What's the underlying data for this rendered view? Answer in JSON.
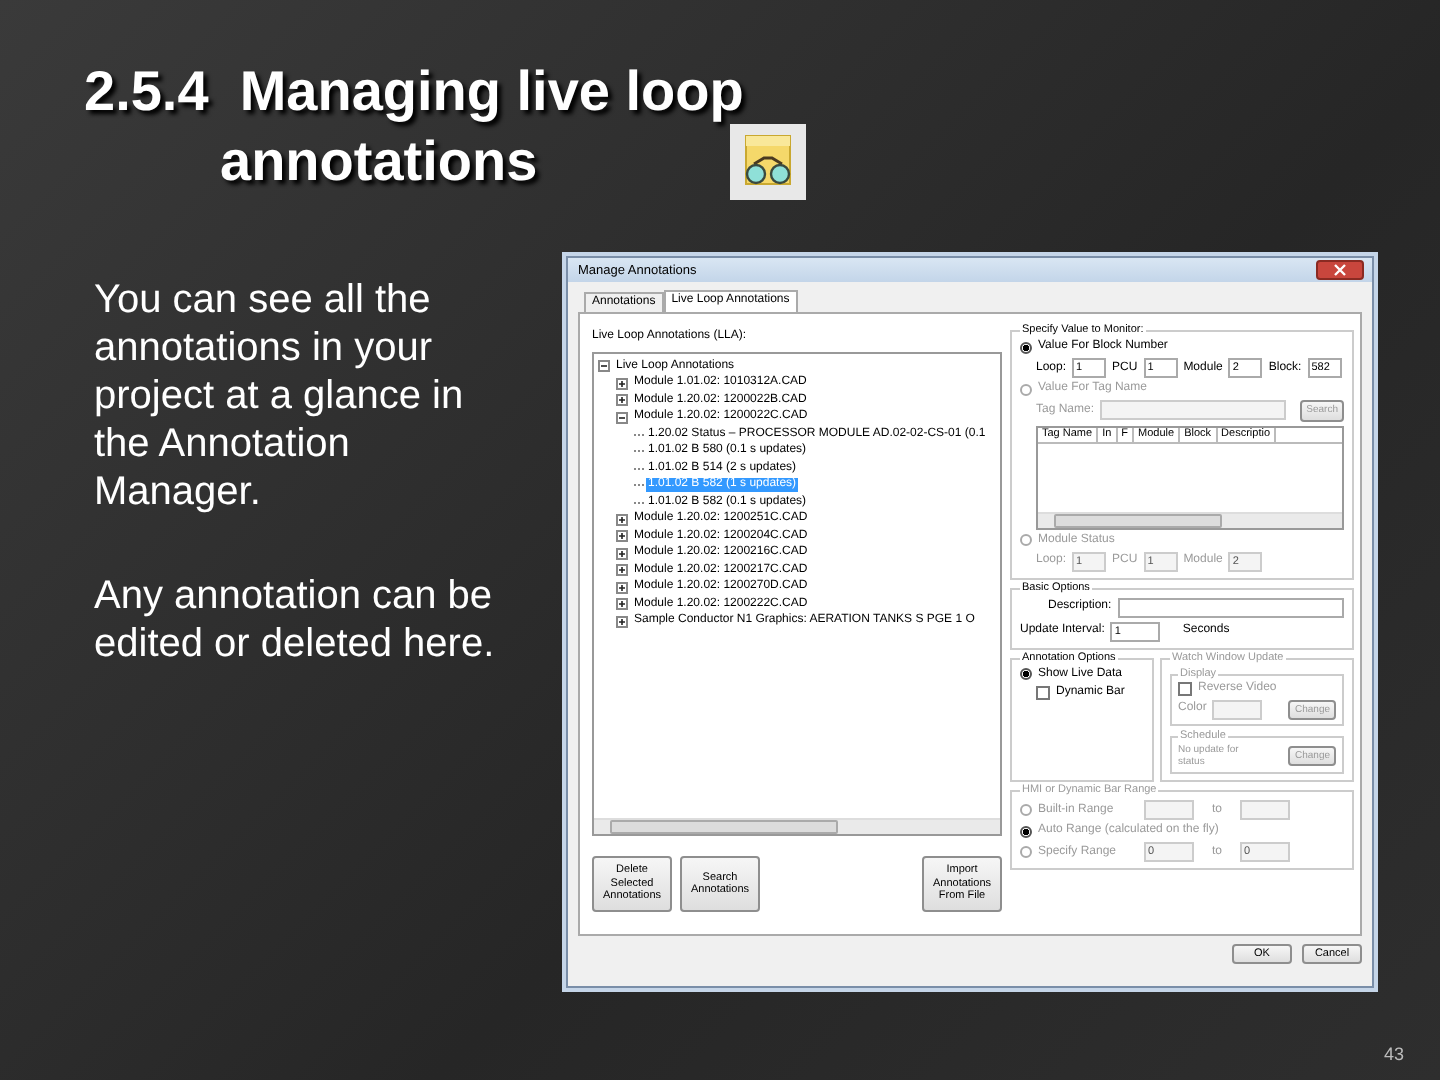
{
  "slide": {
    "title_lines": [
      "2.5.4  Managing live loop",
      "annotations"
    ],
    "paragraphs": [
      "You can see all the annotations in your project at a glance in the Annotation Manager.",
      "Any annotation can be edited or deleted here."
    ],
    "page_number": "43"
  },
  "dialog": {
    "title": "Manage Annotations",
    "tabs": [
      {
        "label": "Annotations",
        "selected": false
      },
      {
        "label": "Live Loop Annotations",
        "selected": true
      }
    ],
    "tree_label": "Live Loop Annotations (LLA):",
    "tree": [
      {
        "label": "Live Loop Annotations",
        "expanded": true,
        "selected": false,
        "children": [
          {
            "label": "Module 1.01.02: 1010312A.CAD",
            "expanded": false,
            "selected": false
          },
          {
            "label": "Module 1.20.02: 1200022B.CAD",
            "expanded": false,
            "selected": false
          },
          {
            "label": "Module 1.20.02: 1200022C.CAD",
            "expanded": true,
            "selected": false,
            "children": [
              {
                "label": "1.20.02 Status – PROCESSOR MODULE AD.02-02-CS-01 (0.1",
                "selected": false
              },
              {
                "label": "1.01.02 B 580 (0.1 s updates)",
                "selected": false
              },
              {
                "label": "1.01.02 B 514 (2 s updates)",
                "selected": false
              },
              {
                "label": "1.01.02 B 582 (1 s updates)",
                "selected": true
              },
              {
                "label": "1.01.02 B 582 (0.1 s updates)",
                "selected": false
              }
            ]
          },
          {
            "label": "Module 1.20.02: 1200251C.CAD",
            "expanded": false,
            "selected": false
          },
          {
            "label": "Module 1.20.02: 1200204C.CAD",
            "expanded": false,
            "selected": false
          },
          {
            "label": "Module 1.20.02: 1200216C.CAD",
            "expanded": false,
            "selected": false
          },
          {
            "label": "Module 1.20.02: 1200217C.CAD",
            "expanded": false,
            "selected": false
          },
          {
            "label": "Module 1.20.02: 1200270D.CAD",
            "expanded": false,
            "selected": false
          },
          {
            "label": "Module 1.20.02: 1200222C.CAD",
            "expanded": false,
            "selected": false
          },
          {
            "label": "Sample Conductor N1 Graphics: AERATION TANKS S PGE 1 O",
            "expanded": false,
            "selected": false
          }
        ]
      }
    ],
    "left_buttons": [
      "Delete Selected Annotations",
      "Search Annotations",
      "Import Annotations From File"
    ],
    "monitor": {
      "title": "Specify Value to Monitor:",
      "block": {
        "label": "Value For Block Number",
        "selected": true,
        "fields": [
          {
            "label": "Loop:",
            "value": "1"
          },
          {
            "label": "PCU",
            "value": "1"
          },
          {
            "label": "Module",
            "value": "2"
          },
          {
            "label": "Block:",
            "value": "582"
          }
        ]
      },
      "tag": {
        "label": "Value For Tag Name",
        "selected": false,
        "field_label": "Tag Name:",
        "search_button": "Search",
        "columns": [
          "Tag Name",
          "In",
          "F",
          "Module",
          "Block",
          "Descriptio"
        ]
      },
      "module": {
        "label": "Module Status",
        "selected": false,
        "fields": [
          {
            "label": "Loop:",
            "value": "1"
          },
          {
            "label": "PCU",
            "value": "1"
          },
          {
            "label": "Module",
            "value": "2"
          }
        ]
      }
    },
    "basic": {
      "title": "Basic Options",
      "description_label": "Description:",
      "interval_label": "Update Interval:",
      "interval": "1",
      "unit": "Seconds"
    },
    "annotation_options": {
      "title": "Annotation Options",
      "show_live": {
        "label": "Show Live Data",
        "selected": true
      },
      "dynamic_bar": {
        "label": "Dynamic Bar",
        "checked": false
      }
    },
    "watch": {
      "title": "Watch Window Update",
      "disabled": true,
      "display_title": "Display",
      "reverse": {
        "label": "Reverse Video",
        "checked": false
      },
      "color_label": "Color",
      "change_button": "Change",
      "schedule_title": "Schedule",
      "schedule_text": "No update for status",
      "schedule_button": "Change"
    },
    "range": {
      "title": "HMI or Dynamic Bar Range",
      "disabled": true,
      "options": [
        {
          "kind": "range",
          "label": "Built-in Range",
          "selected": false,
          "to_label": "to"
        },
        {
          "kind": "auto",
          "label": "Auto Range (calculated on the fly)",
          "selected": true
        },
        {
          "kind": "range",
          "label": "Specify Range",
          "selected": false,
          "from": "0",
          "to_label": "to",
          "to": "0"
        }
      ]
    },
    "footer_buttons": [
      "OK",
      "Cancel"
    ]
  }
}
